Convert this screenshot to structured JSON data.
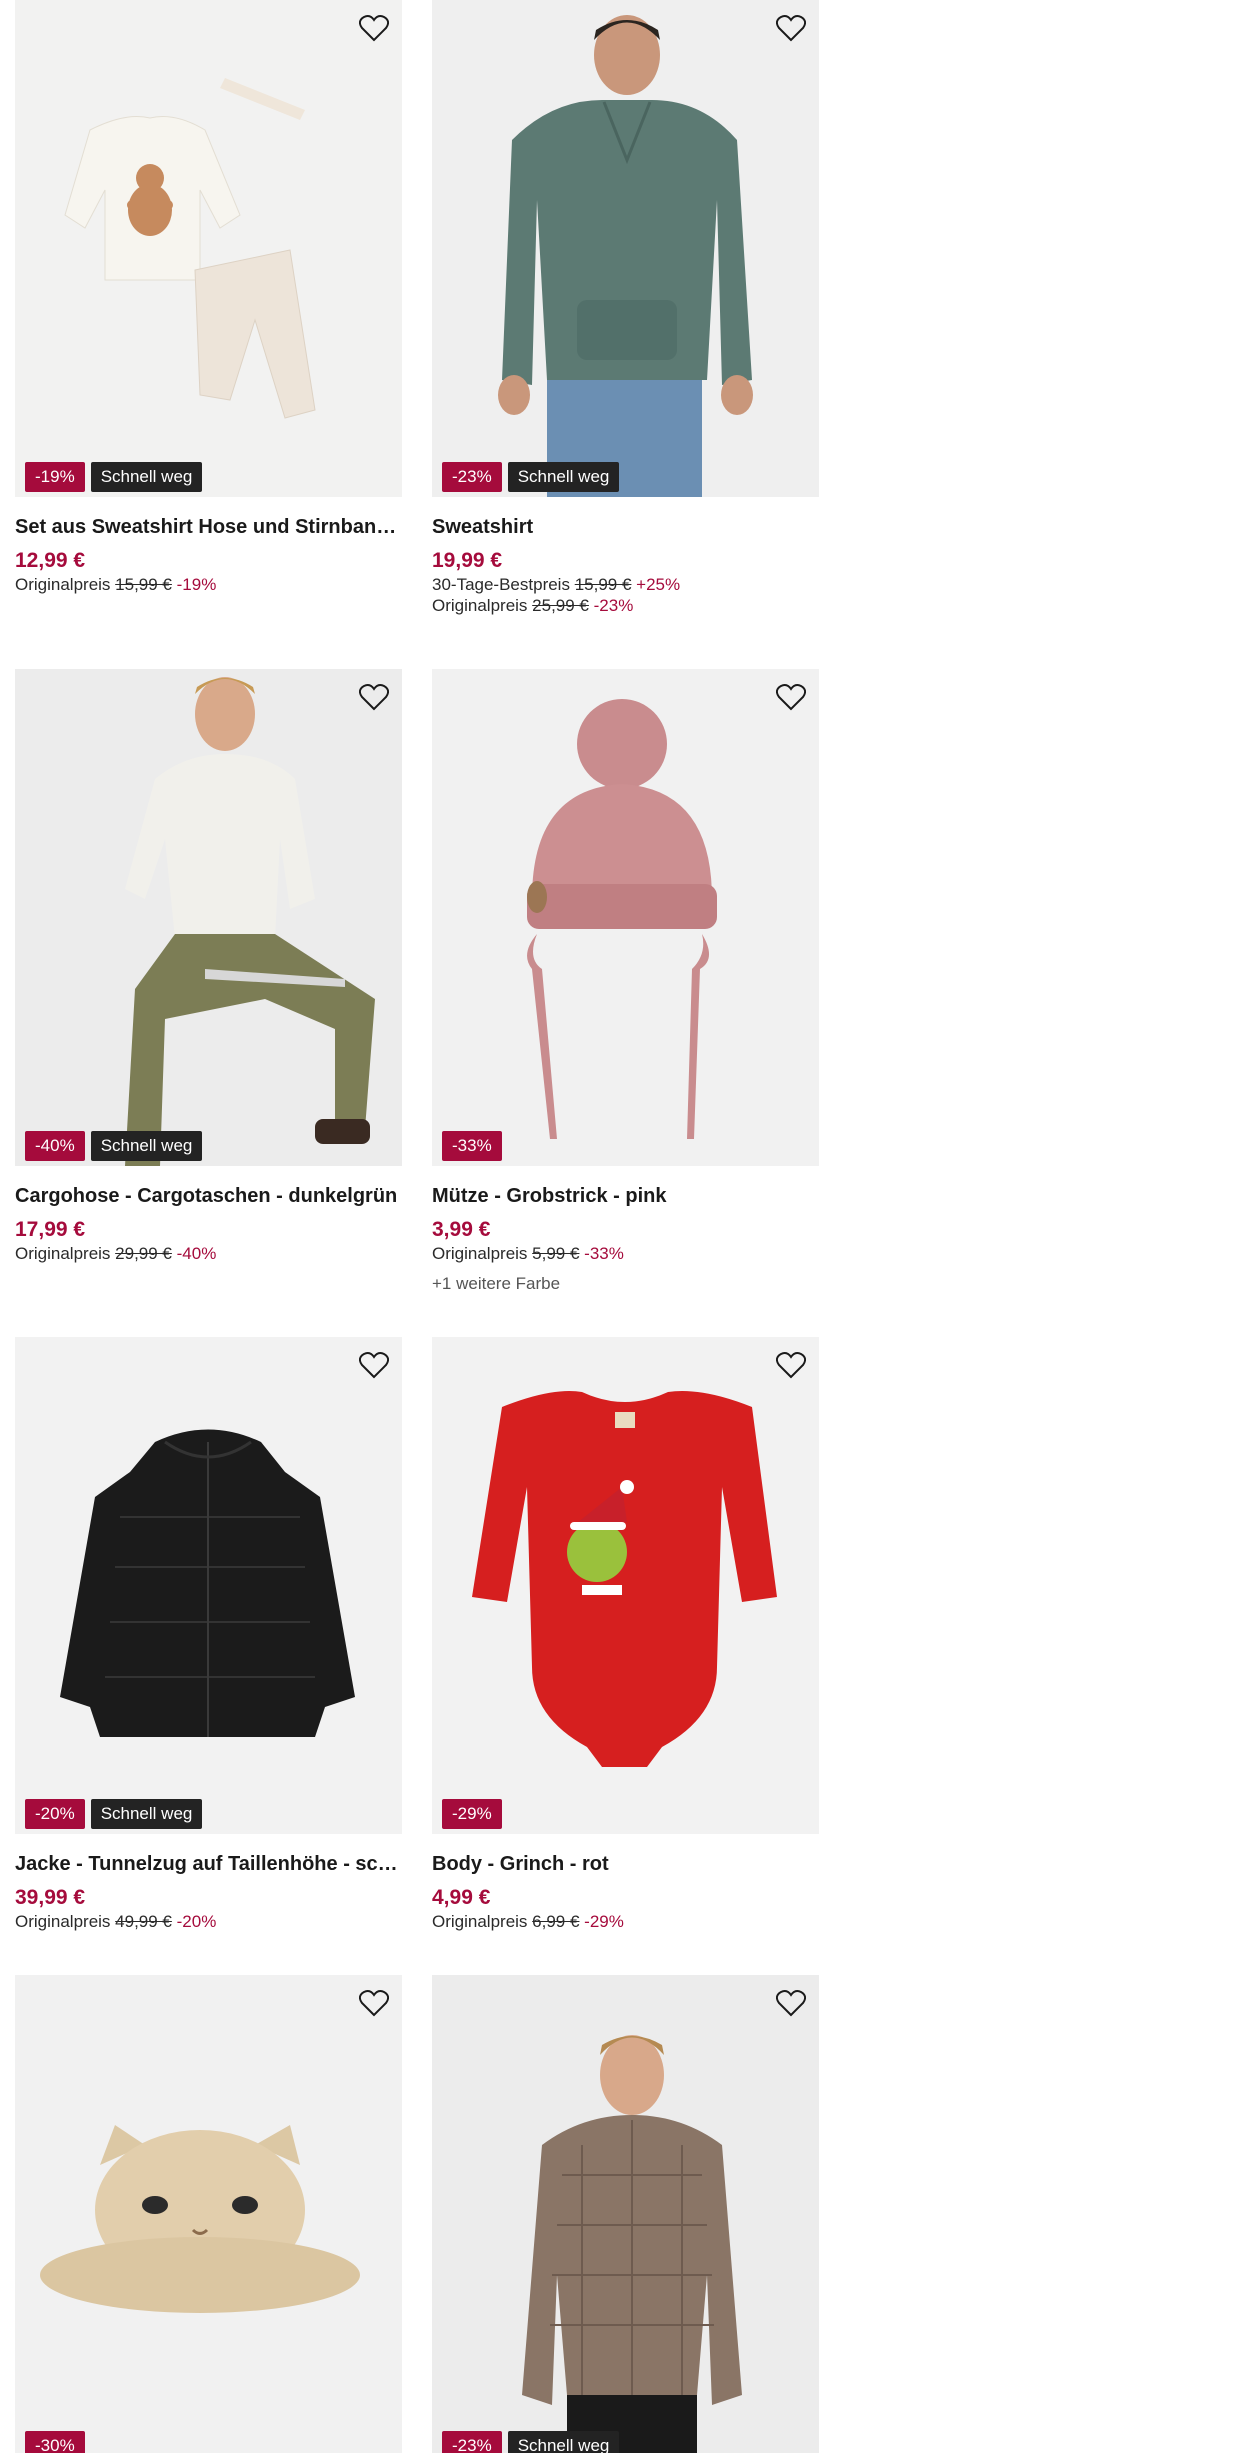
{
  "products": [
    {
      "title": "Set aus Sweatshirt Hose und Stirnband - ...",
      "price": "12,99 €",
      "badge_discount": "-19%",
      "badge_fast": "Schnell weg",
      "orig_label": "Originalpreis",
      "orig_price": "15,99 €",
      "orig_pct": "-19%",
      "image_icon": "baby-set-gingerbread-image"
    },
    {
      "title": "Sweatshirt",
      "price": "19,99 €",
      "badge_discount": "-23%",
      "badge_fast": "Schnell weg",
      "best_label": "30-Tage-Bestpreis",
      "best_price": "15,99 €",
      "best_pct": "+25%",
      "orig_label": "Originalpreis",
      "orig_price": "25,99 €",
      "orig_pct": "-23%",
      "image_icon": "green-sweatshirt-model-image"
    },
    {
      "title": "Cargohose - Cargotaschen - dunkelgrün",
      "price": "17,99 €",
      "badge_discount": "-40%",
      "badge_fast": "Schnell weg",
      "orig_label": "Originalpreis",
      "orig_price": "29,99 €",
      "orig_pct": "-40%",
      "image_icon": "cargo-pants-model-image"
    },
    {
      "title": "Mütze - Grobstrick - pink",
      "price": "3,99 €",
      "badge_discount": "-33%",
      "orig_label": "Originalpreis",
      "orig_price": "5,99 €",
      "orig_pct": "-33%",
      "more_colors": "+1 weitere Farbe",
      "image_icon": "pink-knit-hat-image"
    },
    {
      "title": "Jacke - Tunnelzug auf Taillenhöhe - schw...",
      "price": "39,99 €",
      "badge_discount": "-20%",
      "badge_fast": "Schnell weg",
      "orig_label": "Originalpreis",
      "orig_price": "49,99 €",
      "orig_pct": "-20%",
      "image_icon": "black-puffer-jacket-image"
    },
    {
      "title": "Body - Grinch - rot",
      "price": "4,99 €",
      "badge_discount": "-29%",
      "orig_label": "Originalpreis",
      "orig_price": "6,99 €",
      "orig_pct": "-29%",
      "image_icon": "red-grinch-bodysuit-image"
    },
    {
      "badge_discount": "-30%",
      "image_icon": "cat-straw-hat-image"
    },
    {
      "badge_discount": "-23%",
      "badge_fast": "Schnell weg",
      "image_icon": "checked-shirt-model-image"
    }
  ],
  "colors": {
    "accent": "#a50b3c",
    "badge_dark": "#232323",
    "image_bg": "#f3f3f3"
  }
}
